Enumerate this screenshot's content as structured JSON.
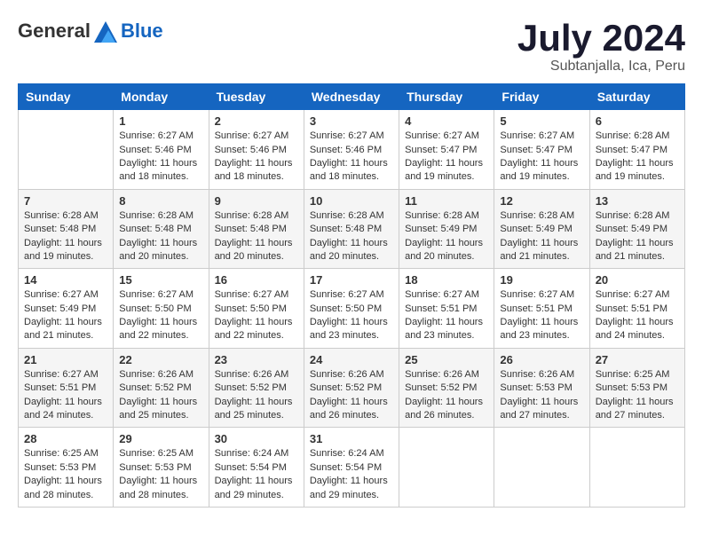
{
  "header": {
    "logo_general": "General",
    "logo_blue": "Blue",
    "month_title": "July 2024",
    "subtitle": "Subtanjalla, Ica, Peru"
  },
  "calendar": {
    "days_of_week": [
      "Sunday",
      "Monday",
      "Tuesday",
      "Wednesday",
      "Thursday",
      "Friday",
      "Saturday"
    ],
    "weeks": [
      [
        {
          "day": "",
          "info": ""
        },
        {
          "day": "1",
          "info": "Sunrise: 6:27 AM\nSunset: 5:46 PM\nDaylight: 11 hours and 18 minutes."
        },
        {
          "day": "2",
          "info": "Sunrise: 6:27 AM\nSunset: 5:46 PM\nDaylight: 11 hours and 18 minutes."
        },
        {
          "day": "3",
          "info": "Sunrise: 6:27 AM\nSunset: 5:46 PM\nDaylight: 11 hours and 18 minutes."
        },
        {
          "day": "4",
          "info": "Sunrise: 6:27 AM\nSunset: 5:47 PM\nDaylight: 11 hours and 19 minutes."
        },
        {
          "day": "5",
          "info": "Sunrise: 6:27 AM\nSunset: 5:47 PM\nDaylight: 11 hours and 19 minutes."
        },
        {
          "day": "6",
          "info": "Sunrise: 6:28 AM\nSunset: 5:47 PM\nDaylight: 11 hours and 19 minutes."
        }
      ],
      [
        {
          "day": "7",
          "info": ""
        },
        {
          "day": "8",
          "info": "Sunrise: 6:28 AM\nSunset: 5:48 PM\nDaylight: 11 hours and 20 minutes."
        },
        {
          "day": "9",
          "info": "Sunrise: 6:28 AM\nSunset: 5:48 PM\nDaylight: 11 hours and 20 minutes."
        },
        {
          "day": "10",
          "info": "Sunrise: 6:28 AM\nSunset: 5:48 PM\nDaylight: 11 hours and 20 minutes."
        },
        {
          "day": "11",
          "info": "Sunrise: 6:28 AM\nSunset: 5:49 PM\nDaylight: 11 hours and 20 minutes."
        },
        {
          "day": "12",
          "info": "Sunrise: 6:28 AM\nSunset: 5:49 PM\nDaylight: 11 hours and 21 minutes."
        },
        {
          "day": "13",
          "info": "Sunrise: 6:28 AM\nSunset: 5:49 PM\nDaylight: 11 hours and 21 minutes."
        }
      ],
      [
        {
          "day": "14",
          "info": ""
        },
        {
          "day": "15",
          "info": "Sunrise: 6:27 AM\nSunset: 5:50 PM\nDaylight: 11 hours and 22 minutes."
        },
        {
          "day": "16",
          "info": "Sunrise: 6:27 AM\nSunset: 5:50 PM\nDaylight: 11 hours and 22 minutes."
        },
        {
          "day": "17",
          "info": "Sunrise: 6:27 AM\nSunset: 5:50 PM\nDaylight: 11 hours and 23 minutes."
        },
        {
          "day": "18",
          "info": "Sunrise: 6:27 AM\nSunset: 5:51 PM\nDaylight: 11 hours and 23 minutes."
        },
        {
          "day": "19",
          "info": "Sunrise: 6:27 AM\nSunset: 5:51 PM\nDaylight: 11 hours and 23 minutes."
        },
        {
          "day": "20",
          "info": "Sunrise: 6:27 AM\nSunset: 5:51 PM\nDaylight: 11 hours and 24 minutes."
        }
      ],
      [
        {
          "day": "21",
          "info": ""
        },
        {
          "day": "22",
          "info": "Sunrise: 6:26 AM\nSunset: 5:52 PM\nDaylight: 11 hours and 25 minutes."
        },
        {
          "day": "23",
          "info": "Sunrise: 6:26 AM\nSunset: 5:52 PM\nDaylight: 11 hours and 25 minutes."
        },
        {
          "day": "24",
          "info": "Sunrise: 6:26 AM\nSunset: 5:52 PM\nDaylight: 11 hours and 26 minutes."
        },
        {
          "day": "25",
          "info": "Sunrise: 6:26 AM\nSunset: 5:52 PM\nDaylight: 11 hours and 26 minutes."
        },
        {
          "day": "26",
          "info": "Sunrise: 6:26 AM\nSunset: 5:53 PM\nDaylight: 11 hours and 27 minutes."
        },
        {
          "day": "27",
          "info": "Sunrise: 6:25 AM\nSunset: 5:53 PM\nDaylight: 11 hours and 27 minutes."
        }
      ],
      [
        {
          "day": "28",
          "info": "Sunrise: 6:25 AM\nSunset: 5:53 PM\nDaylight: 11 hours and 28 minutes."
        },
        {
          "day": "29",
          "info": "Sunrise: 6:25 AM\nSunset: 5:53 PM\nDaylight: 11 hours and 28 minutes."
        },
        {
          "day": "30",
          "info": "Sunrise: 6:24 AM\nSunset: 5:54 PM\nDaylight: 11 hours and 29 minutes."
        },
        {
          "day": "31",
          "info": "Sunrise: 6:24 AM\nSunset: 5:54 PM\nDaylight: 11 hours and 29 minutes."
        },
        {
          "day": "",
          "info": ""
        },
        {
          "day": "",
          "info": ""
        },
        {
          "day": "",
          "info": ""
        }
      ]
    ],
    "week7_sunday": {
      "day": "7",
      "info": "Sunrise: 6:28 AM\nSunset: 5:48 PM\nDaylight: 11 hours and 19 minutes."
    },
    "week3_sunday": {
      "day": "14",
      "info": "Sunrise: 6:27 AM\nSunset: 5:49 PM\nDaylight: 11 hours and 21 minutes."
    },
    "week4_sunday": {
      "day": "21",
      "info": "Sunrise: 6:27 AM\nSunset: 5:51 PM\nDaylight: 11 hours and 24 minutes."
    }
  }
}
